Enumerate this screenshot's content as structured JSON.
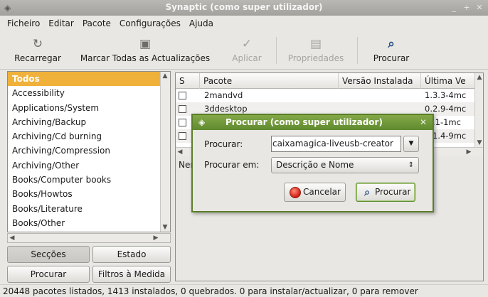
{
  "window": {
    "title": "Synaptic (como super utilizador)"
  },
  "menubar": [
    {
      "label": "Ficheiro"
    },
    {
      "label": "Editar"
    },
    {
      "label": "Pacote"
    },
    {
      "label": "Configurações"
    },
    {
      "label": "Ajuda"
    }
  ],
  "toolbar": {
    "reload": "Recarregar",
    "mark_all": "Marcar Todas as Actualizações",
    "apply": "Aplicar",
    "properties": "Propriedades",
    "search": "Procurar"
  },
  "sections": {
    "items": [
      "Todos",
      "Accessibility",
      "Applications/System",
      "Archiving/Backup",
      "Archiving/Cd burning",
      "Archiving/Compression",
      "Archiving/Other",
      "Books/Computer books",
      "Books/Howtos",
      "Books/Literature",
      "Books/Other"
    ],
    "selected": "Todos"
  },
  "filter_buttons": {
    "sections": "Secções",
    "status": "Estado",
    "search": "Procurar",
    "custom_filters": "Filtros à Medida"
  },
  "packages": {
    "columns": [
      "S",
      "Pacote",
      "Versão Instalada",
      "Última Ve"
    ],
    "rows": [
      {
        "name": "2mandvd",
        "installed": "",
        "latest": "1.3.3-4mc"
      },
      {
        "name": "3ddesktop",
        "installed": "",
        "latest": "0.2.9-4mc"
      },
      {
        "name": "",
        "installed": "",
        "latest": ".6.1-1mc"
      },
      {
        "name": "",
        "installed": "",
        "latest": "2.1.4-9mc"
      }
    ]
  },
  "details": {
    "partial_label": "Nen"
  },
  "dialog": {
    "title": "Procurar (como super utilizador)",
    "search_label": "Procurar:",
    "search_value": "caixamagica-liveusb-creator",
    "search_in_label": "Procurar em:",
    "search_in_value": "Descrição e Nome",
    "cancel": "Cancelar",
    "search_button": "Procurar"
  },
  "statusbar": "20448 pacotes listados, 1413 instalados, 0 quebrados. 0 para instalar/actualizar, 0 para remover"
}
